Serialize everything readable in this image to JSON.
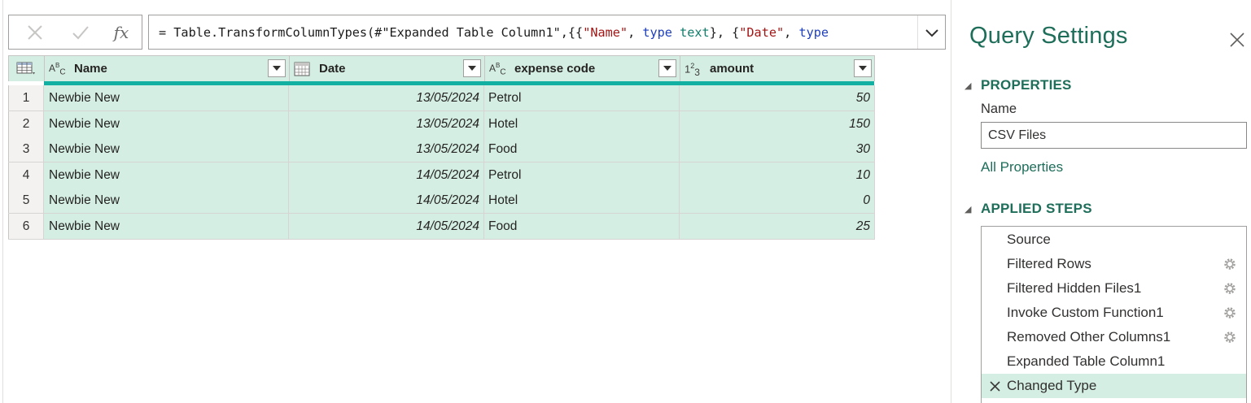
{
  "formula_bar": {
    "fx_label": "fx",
    "formula_tokens": [
      {
        "t": "= Table.TransformColumnTypes(#",
        "k": "plain"
      },
      {
        "t": "\"Expanded Table Column1\"",
        "k": "plain"
      },
      {
        "t": ",{{",
        "k": "plain"
      },
      {
        "t": "\"Name\"",
        "k": "str"
      },
      {
        "t": ", ",
        "k": "plain"
      },
      {
        "t": "type",
        "k": "kw"
      },
      {
        "t": " ",
        "k": "plain"
      },
      {
        "t": "text",
        "k": "ty"
      },
      {
        "t": "}, {",
        "k": "plain"
      },
      {
        "t": "\"Date\"",
        "k": "str"
      },
      {
        "t": ", ",
        "k": "plain"
      },
      {
        "t": "type",
        "k": "kw"
      }
    ]
  },
  "grid": {
    "columns": [
      {
        "name": "Name",
        "type_icon": "ABC"
      },
      {
        "name": "Date",
        "type_icon": "calendar"
      },
      {
        "name": "expense code",
        "type_icon": "ABC"
      },
      {
        "name": "amount",
        "type_icon": "123"
      }
    ],
    "rows": [
      {
        "index": "1",
        "name": "Newbie New",
        "date": "13/05/2024",
        "expense_code": "Petrol",
        "amount": "50"
      },
      {
        "index": "2",
        "name": "Newbie New",
        "date": "13/05/2024",
        "expense_code": "Hotel",
        "amount": "150"
      },
      {
        "index": "3",
        "name": "Newbie New",
        "date": "13/05/2024",
        "expense_code": "Food",
        "amount": "30"
      },
      {
        "index": "4",
        "name": "Newbie New",
        "date": "14/05/2024",
        "expense_code": "Petrol",
        "amount": "10"
      },
      {
        "index": "5",
        "name": "Newbie New",
        "date": "14/05/2024",
        "expense_code": "Hotel",
        "amount": "0"
      },
      {
        "index": "6",
        "name": "Newbie New",
        "date": "14/05/2024",
        "expense_code": "Food",
        "amount": "25"
      }
    ]
  },
  "query_settings": {
    "title": "Query Settings",
    "properties_heading": "PROPERTIES",
    "name_label": "Name",
    "name_value": "CSV Files",
    "all_properties_link": "All Properties",
    "applied_steps_heading": "APPLIED STEPS",
    "steps": [
      {
        "label": "Source",
        "has_gear": false,
        "selected": false
      },
      {
        "label": "Filtered Rows",
        "has_gear": true,
        "selected": false
      },
      {
        "label": "Filtered Hidden Files1",
        "has_gear": true,
        "selected": false
      },
      {
        "label": "Invoke Custom Function1",
        "has_gear": true,
        "selected": false
      },
      {
        "label": "Removed Other Columns1",
        "has_gear": true,
        "selected": false
      },
      {
        "label": "Expanded Table Column1",
        "has_gear": false,
        "selected": false
      },
      {
        "label": "Changed Type",
        "has_gear": false,
        "selected": true
      }
    ]
  },
  "colors": {
    "accent": "#1e6e5a",
    "grid_fill": "#d4eee3",
    "column_quality_bar": "#12b0a2"
  }
}
